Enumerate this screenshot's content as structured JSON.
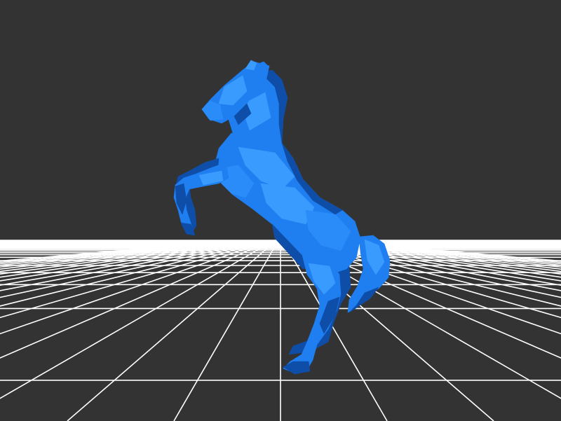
{
  "viewer": {
    "background_color": "#333333",
    "grid_color": "#ffffff",
    "model": {
      "name": "horse",
      "pose": "rearing",
      "color": "#1f7ff0",
      "highlight_color": "#3a9bff",
      "shadow_color": "#0f4ea8",
      "style": "low-poly"
    }
  }
}
